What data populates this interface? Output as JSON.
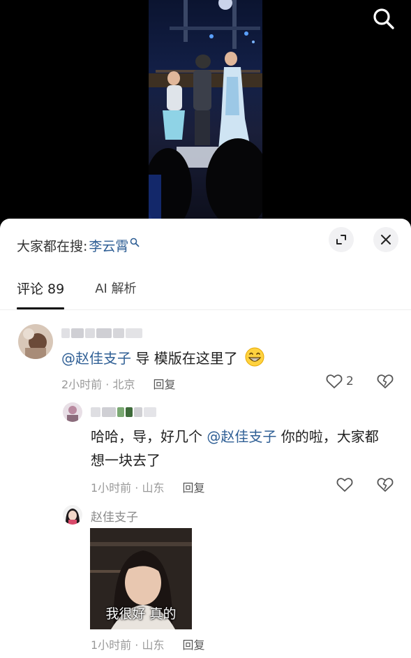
{
  "trending": {
    "prefix": "大家都在搜:",
    "keyword": "李云霄"
  },
  "tabs": [
    {
      "label": "评论 89"
    },
    {
      "label": "AI 解析"
    }
  ],
  "comments": [
    {
      "mention": "@赵佳支子",
      "text": " 导 模版在这里了",
      "emoji": "grin-icon",
      "time_location": "2小时前 · 北京",
      "reply_label": "回复",
      "like_count": "2",
      "replies": [
        {
          "text_before": "哈哈，导，好几个 ",
          "mention": "@赵佳支子",
          "text_after": " 你的啦，大家都想一块去了",
          "time_location": "1小时前 · 山东",
          "reply_label": "回复"
        },
        {
          "author": "赵佳支子",
          "sticker_caption": "我很好 真的",
          "time_location": "1小时前 · 山东",
          "reply_label": "回复"
        }
      ]
    }
  ],
  "colors": {
    "accent_link": "#2f5f95",
    "meta_gray": "#999999"
  }
}
